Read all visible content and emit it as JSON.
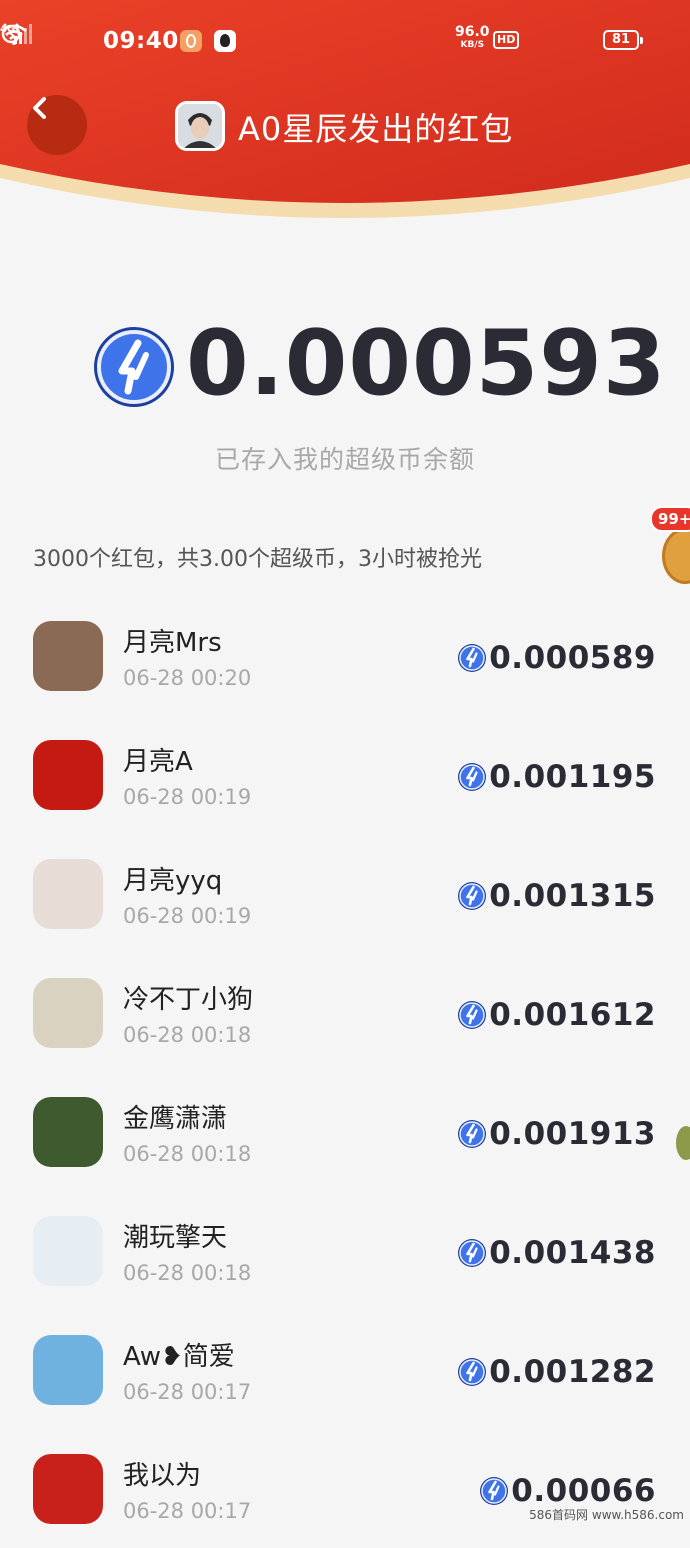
{
  "status_bar": {
    "time": "09:40",
    "speed_value": "96.0",
    "speed_unit": "KB/S",
    "hd": "HD",
    "network": "4G",
    "battery": "81"
  },
  "header": {
    "title": "A0星辰发出的红包",
    "colors": {
      "red_top": "#e73a2a",
      "red_bottom": "#d12b1d",
      "gold_band": "#f5dcae"
    }
  },
  "amount": {
    "value": "0.000593",
    "caption": "已存入我的超级币余额"
  },
  "summary": "3000个红包，共3.00个超级币，3小时被抢光",
  "badge": {
    "count": "99+"
  },
  "records": [
    {
      "name": "月亮Mrs",
      "time": "06-28 00:20",
      "amount": "0.000589",
      "avatar_color": "#8a6a55"
    },
    {
      "name": "月亮A",
      "time": "06-28 00:19",
      "amount": "0.001195",
      "avatar_color": "#c41a12"
    },
    {
      "name": "月亮yyq",
      "time": "06-28 00:19",
      "amount": "0.001315",
      "avatar_color": "#e8ddd6"
    },
    {
      "name": "冷不丁小狗",
      "time": "06-28 00:18",
      "amount": "0.001612",
      "avatar_color": "#d9d2c0"
    },
    {
      "name": "金鹰潇潇",
      "time": "06-28 00:18",
      "amount": "0.001913",
      "avatar_color": "#3f5a2e"
    },
    {
      "name": "潮玩擎天",
      "time": "06-28 00:18",
      "amount": "0.001438",
      "avatar_color": "#e6eef3"
    },
    {
      "name": "Aw❥简爱",
      "time": "06-28 00:17",
      "amount": "0.001282",
      "avatar_color": "#6fb2e0"
    },
    {
      "name": "我以为",
      "time": "06-28 00:17",
      "amount": "0.00066",
      "avatar_color": "#c8201a"
    }
  ],
  "watermark": "586首码网 www.h586.com",
  "coin_color": "#2f5fe0"
}
